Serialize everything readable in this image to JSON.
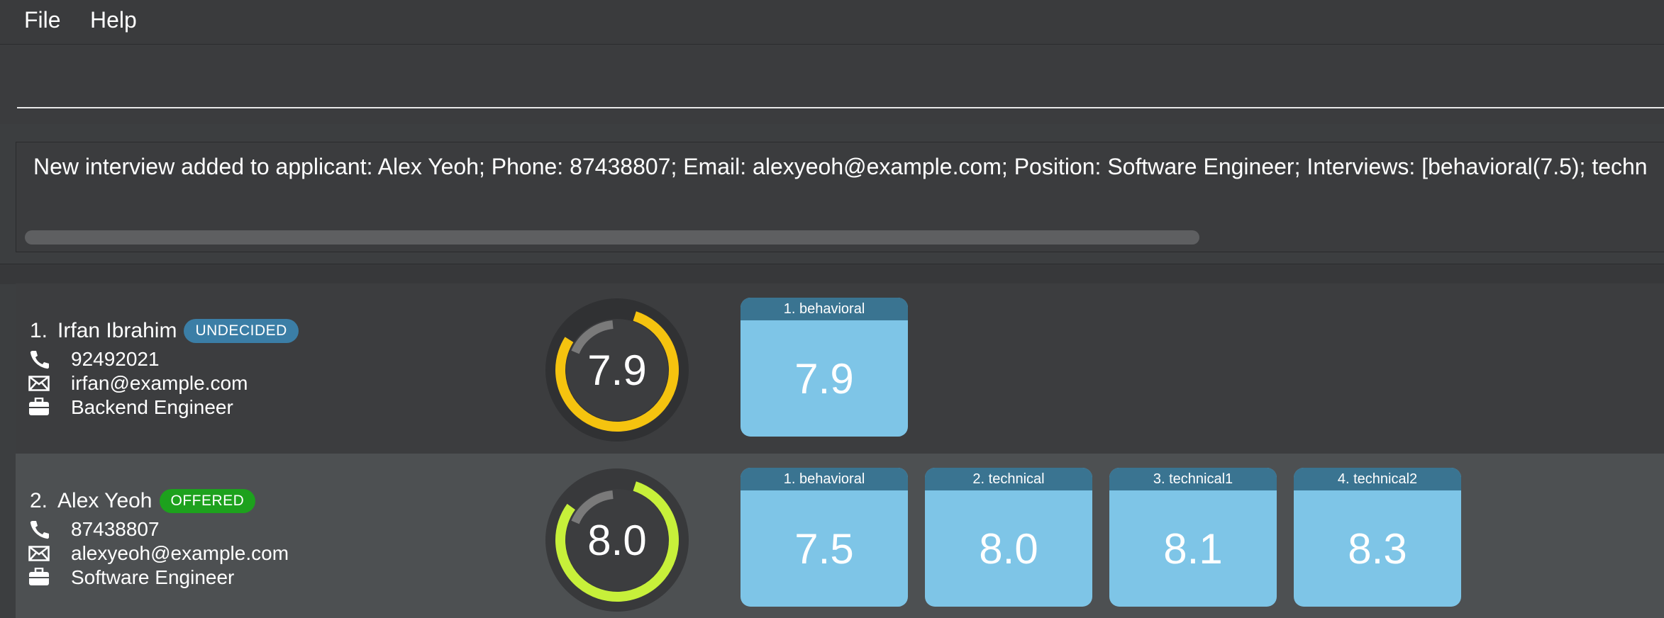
{
  "menubar": {
    "file_label": "File",
    "help_label": "Help"
  },
  "command_box": {
    "value": ""
  },
  "result_display": {
    "text": "New interview added to applicant: Alex Yeoh; Phone: 87438807; Email: alexyeoh@example.com; Position: Software Engineer; Interviews: [behavioral(7.5); techn"
  },
  "applicants": [
    {
      "index": "1.",
      "name": "Irfan Ibrahim",
      "status": "UNDECIDED",
      "phone": "92492021",
      "email": "irfan@example.com",
      "position": "Backend Engineer",
      "overall_score": "7.9",
      "score_fraction": 0.79,
      "ring_color": "#f5c30f",
      "interviews": [
        {
          "label": "1. behavioral",
          "score": "7.9"
        }
      ]
    },
    {
      "index": "2.",
      "name": "Alex Yeoh",
      "status": "OFFERED",
      "phone": "87438807",
      "email": "alexyeoh@example.com",
      "position": "Software Engineer",
      "overall_score": "8.0",
      "score_fraction": 0.8,
      "ring_color": "#c7f03a",
      "interviews": [
        {
          "label": "1. behavioral",
          "score": "7.5"
        },
        {
          "label": "2. technical",
          "score": "8.0"
        },
        {
          "label": "3. technical1",
          "score": "8.1"
        },
        {
          "label": "4. technical2",
          "score": "8.3"
        }
      ]
    }
  ],
  "colors": {
    "background": "#3c3e40",
    "undecided_badge": "#3b7ea6",
    "offered_badge": "#1da11d",
    "tile_body": "#7ec5e7",
    "tile_header": "#3a7491"
  },
  "icons": {
    "phone": "phone-icon",
    "email": "email-icon",
    "position": "briefcase-icon"
  }
}
